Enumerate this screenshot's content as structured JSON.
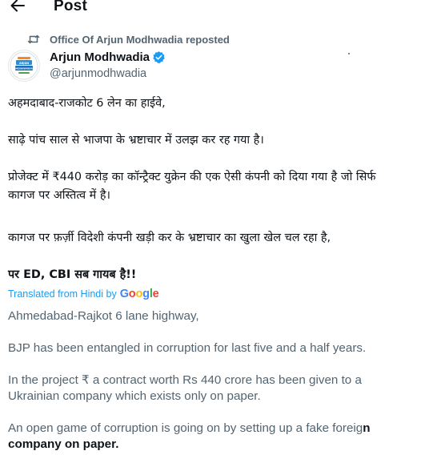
{
  "header": {
    "title": "Post"
  },
  "repost": {
    "text": "Office Of Arjun Modhwadia reposted"
  },
  "author": {
    "name": "Arjun Modhwadia",
    "handle": "@arjunmodhwadia",
    "avatar_text": "ARJUN MODHWADIA"
  },
  "post": {
    "hindi_lines": [
      "अहमदाबाद-राजकोट 6 लेन का हाईवे,",
      "साढ़े पांच साल से भाजपा के भ्रष्टाचार में उलझ कर रह गया है।",
      "प्रोजेक्ट में ₹440 करोड़ का कॉन्ट्रैक्ट युक्रेन की एक ऐसी कंपनी को दिया गया है जो सिर्फ",
      "कागज पर अस्तित्व में है।",
      "कागज पर फ़र्ज़ी विदेशी कंपनी खड़ी कर के भ्रष्टाचार का खुला खेल चल रहा है,",
      "पर ED, CBI सब गायब है!!"
    ]
  },
  "translation": {
    "label": "Translated from Hindi by",
    "provider": "Google",
    "lines": [
      "Ahmedabad-Rajkot 6 lane highway,",
      "BJP has been entangled in corruption for last five and a half years.",
      "In the project ₹ a contract worth Rs 440 crore has been given to a",
      "Ukrainian company which exists only on paper.",
      "An open game of corruption is going on by setting up a fake foreig",
      "n",
      "company on paper."
    ]
  },
  "colors": {
    "text_primary": "#0f1419",
    "text_secondary": "#536471",
    "link_blue": "#1d9bf0",
    "verified_blue": "#1d9bf0",
    "google_blue": "#4285f4",
    "google_red": "#ea4335",
    "google_yellow": "#fbbc05",
    "google_green": "#34a853"
  },
  "icons": {
    "back": "left-arrow-icon",
    "repost": "repost-icon",
    "verified": "verified-badge-icon"
  }
}
